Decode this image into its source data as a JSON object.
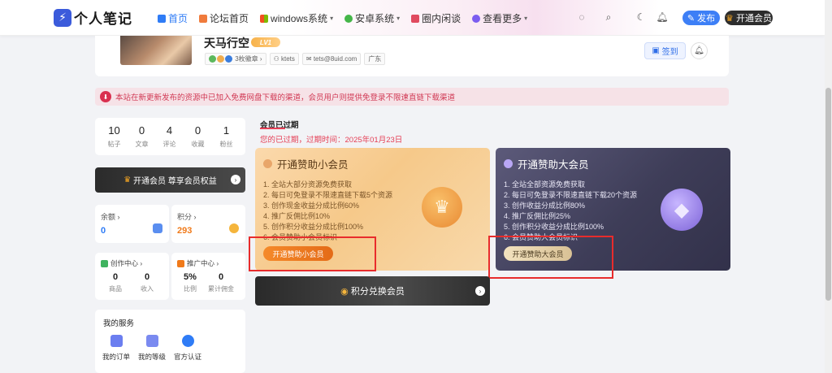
{
  "header": {
    "logo_text": "个人笔记",
    "logo_badge": "⚡",
    "nav": [
      {
        "label": "首页",
        "color": "#2f7cf6"
      },
      {
        "label": "论坛首页",
        "color": "#f07b3c"
      },
      {
        "label": "windows系统",
        "color": "#3a8ee6",
        "caret": "▾"
      },
      {
        "label": "安卓系统",
        "color": "#45b649",
        "caret": "▾"
      },
      {
        "label": "圈内闲谈",
        "color": "#e04a5f"
      },
      {
        "label": "查看更多",
        "color": "#7b5cf0",
        "caret": "▾"
      }
    ],
    "publish_label": "发布",
    "vip_label": "开通会员"
  },
  "profile": {
    "name": "天马行空",
    "level": "LV1",
    "badges_label": "3枚徽章",
    "username": "ktets",
    "email": "tets@8uid.com",
    "location": "广东",
    "sign_label": "签到"
  },
  "notice": {
    "text": "本站在新更新发布的资源中已加入免费网盘下载的渠道，会员用户则提供免登录不限速直链下载渠道"
  },
  "stats": [
    {
      "value": "10",
      "label": "帖子"
    },
    {
      "value": "0",
      "label": "文章"
    },
    {
      "value": "4",
      "label": "评论"
    },
    {
      "value": "0",
      "label": "收藏"
    },
    {
      "value": "1",
      "label": "粉丝"
    }
  ],
  "vip_bar_label": "开通会员 尊享会员权益",
  "balance": {
    "label": "余额",
    "value": "0"
  },
  "points": {
    "label": "积分",
    "value": "293"
  },
  "creation": {
    "title": "创作中心",
    "items": [
      {
        "value": "0",
        "label": "商品"
      },
      {
        "value": "0",
        "label": "收入"
      }
    ]
  },
  "promo": {
    "title": "推广中心",
    "items": [
      {
        "value": "5%",
        "label": "比例"
      },
      {
        "value": "0",
        "label": "累计佣金"
      }
    ]
  },
  "services": {
    "title": "我的服务",
    "items": [
      {
        "label": "我的订单"
      },
      {
        "label": "我的等级"
      },
      {
        "label": "官方认证"
      }
    ]
  },
  "vip_status": {
    "title": "会员已过期",
    "expire_text": "您的已过期，过期时间：2025年01月23日"
  },
  "small_vip": {
    "title": "开通赞助小会员",
    "features": [
      "1. 全站大部分资源免费获取",
      "2. 每日可免登录不限速直链下载5个资源",
      "3. 创作现金收益分成比例60%",
      "4. 推广反佣比例10%",
      "5. 创作积分收益分成比例100%",
      "6. 会员赞助小会员标识"
    ],
    "button": "开通赞助小会员"
  },
  "big_vip": {
    "title": "开通赞助大会员",
    "features": [
      "1. 全站全部资源免费获取",
      "2. 每日可免登录不限速直链下载20个资源",
      "3. 创作收益分成比例80%",
      "4. 推广反佣比例25%",
      "5. 创作积分收益分成比例100%",
      "6. 会员赞助大会员标识"
    ],
    "button": "开通赞助大会员"
  },
  "exchange_label": "积分兑换会员",
  "colors": {
    "accent": "#2f7cf6",
    "danger": "#e53e55",
    "gold": "#f07a1a",
    "highlight_box": "#e82c2c"
  }
}
